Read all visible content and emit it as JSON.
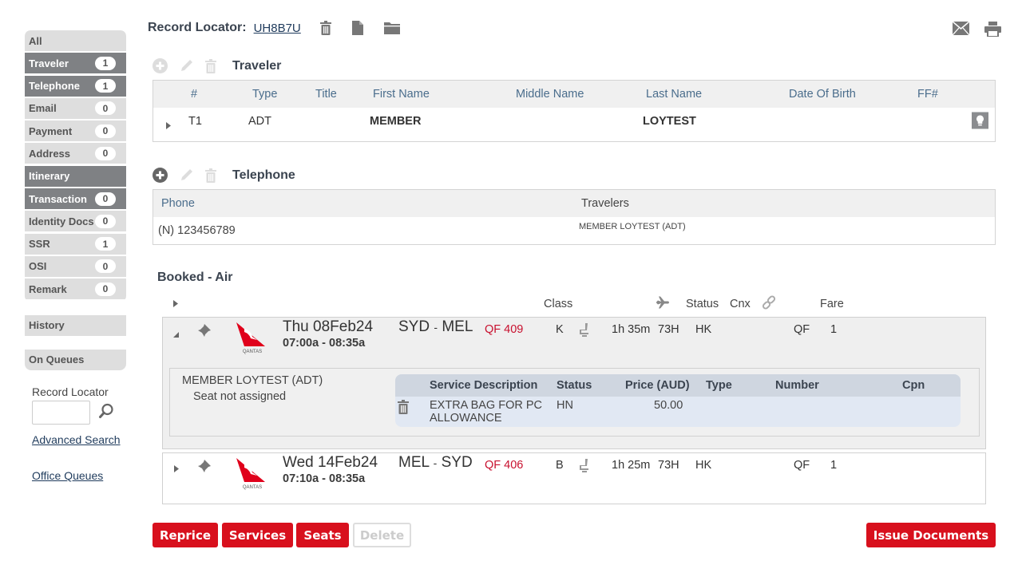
{
  "sidebar": {
    "items": [
      {
        "label": "All",
        "count": null,
        "active": false
      },
      {
        "label": "Traveler",
        "count": "1",
        "active": true
      },
      {
        "label": "Telephone",
        "count": "1",
        "active": true
      },
      {
        "label": "Email",
        "count": "0",
        "active": false
      },
      {
        "label": "Payment",
        "count": "0",
        "active": false
      },
      {
        "label": "Address",
        "count": "0",
        "active": false
      },
      {
        "label": "Itinerary",
        "count": null,
        "active": true
      },
      {
        "label": "Transaction",
        "count": "0",
        "active": true
      },
      {
        "label": "Identity Docs",
        "count": "0",
        "active": false
      },
      {
        "label": "SSR",
        "count": "1",
        "active": false
      },
      {
        "label": "OSI",
        "count": "0",
        "active": false
      },
      {
        "label": "Remark",
        "count": "0",
        "active": false
      }
    ],
    "history": "History",
    "on_queues": "On Queues",
    "record_locator_label": "Record Locator",
    "record_locator_value": "",
    "advanced_search": "Advanced Search",
    "office_queues": "Office Queues"
  },
  "header": {
    "record_locator_label": "Record Locator:",
    "record_locator_value": "UH8B7U"
  },
  "traveler": {
    "title": "Traveler",
    "columns": [
      "#",
      "Type",
      "Title",
      "First Name",
      "Middle Name",
      "Last Name",
      "Date Of Birth",
      "FF#"
    ],
    "rows": [
      {
        "num": "T1",
        "type": "ADT",
        "title": "",
        "first": "MEMBER",
        "middle": "",
        "last": "LOYTEST",
        "dob": "",
        "ff": ""
      }
    ]
  },
  "telephone": {
    "title": "Telephone",
    "columns": [
      "Phone",
      "Travelers"
    ],
    "rows": [
      {
        "phone": "(N) 123456789",
        "travelers": "MEMBER LOYTEST (ADT)"
      }
    ]
  },
  "booked_air": {
    "title": "Booked - Air",
    "columns": {
      "class": "Class",
      "status": "Status",
      "cnx": "Cnx",
      "fare": "Fare"
    },
    "segments": [
      {
        "date": "Thu 08Feb24",
        "times": "07:00a - 08:35a",
        "from": "SYD",
        "to": "MEL",
        "sep": "-",
        "flight": "QF 409",
        "class": "K",
        "duration": "1h 35m",
        "equipment": "73H",
        "status": "HK",
        "fare_carrier": "QF",
        "fare_num": "1",
        "airline_logo_text": "QANTAS",
        "expanded": true,
        "detail": {
          "passenger": "MEMBER LOYTEST (ADT)",
          "seat": "Seat not assigned",
          "service_columns": [
            "Service Description",
            "Status",
            "Price (AUD)",
            "Type",
            "Number",
            "Cpn"
          ],
          "services": [
            {
              "description": "EXTRA BAG FOR PC ALLOWANCE",
              "status": "HN",
              "price": "50.00",
              "type": "",
              "number": "",
              "cpn": ""
            }
          ]
        }
      },
      {
        "date": "Wed 14Feb24",
        "times": "07:10a - 08:35a",
        "from": "MEL",
        "to": "SYD",
        "sep": "-",
        "flight": "QF 406",
        "class": "B",
        "duration": "1h 25m",
        "equipment": "73H",
        "status": "HK",
        "fare_carrier": "QF",
        "fare_num": "1",
        "airline_logo_text": "QANTAS",
        "expanded": false
      }
    ]
  },
  "actions": {
    "reprice": "Reprice",
    "services": "Services",
    "seats": "Seats",
    "delete": "Delete",
    "issue_documents": "Issue Documents"
  },
  "colors": {
    "accent_red": "#d8101d",
    "nav_active": "#7f8184",
    "link": "#1f3b5c",
    "flight_red": "#c8102e"
  }
}
